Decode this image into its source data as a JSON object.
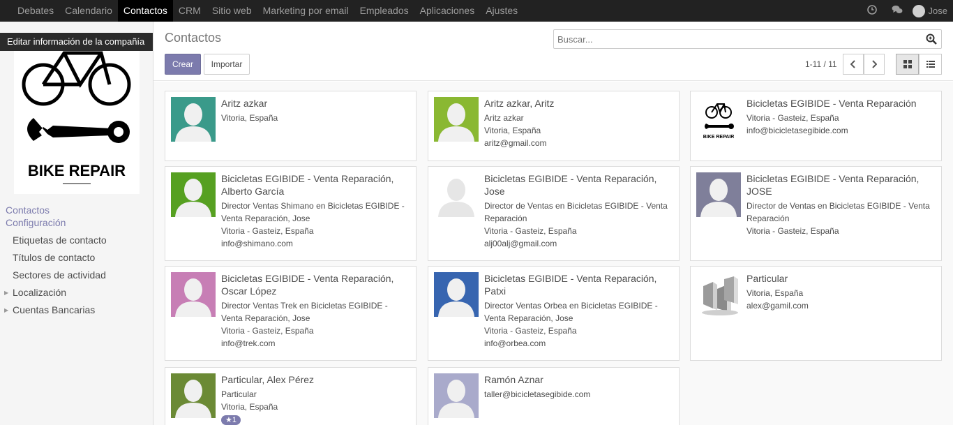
{
  "navbar": {
    "menu": [
      "Debates",
      "Calendario",
      "Contactos",
      "CRM",
      "Sitio web",
      "Marketing por email",
      "Empleados",
      "Aplicaciones",
      "Ajustes"
    ],
    "active_index": 2,
    "user": "Jose",
    "icons": [
      "clock-icon",
      "chat-icon"
    ]
  },
  "sidebar": {
    "tooltip": "Editar información de la compañía",
    "logo_text": "BIKE REPAIR",
    "sections": [
      "Contactos",
      "Configuración"
    ],
    "items": [
      "Etiquetas de contacto",
      "Títulos de contacto",
      "Sectores de actividad",
      "Localización",
      "Cuentas Bancarias"
    ]
  },
  "control": {
    "title": "Contactos",
    "search_placeholder": "Buscar...",
    "create_label": "Crear",
    "import_label": "Importar",
    "pager": "1-11 / 11"
  },
  "colors": {
    "accent": "#7c7bad",
    "navbar": "#222222"
  },
  "contacts": [
    {
      "name": "Aritz azkar",
      "lines": [
        "Vitoria, España"
      ],
      "avatar_color": "#3a9a8a"
    },
    {
      "name": "Aritz azkar, Aritz",
      "lines": [
        "Aritz azkar",
        "Vitoria, España",
        "aritz@gmail.com"
      ],
      "avatar_color": "#8ab832"
    },
    {
      "name": "Bicicletas EGIBIDE - Venta Reparación",
      "lines": [
        "Vitoria - Gasteiz, España",
        "info@bicicletasegibide.com"
      ],
      "avatar_color": "logo"
    },
    {
      "name": "Bicicletas EGIBIDE - Venta Reparación, Alberto García",
      "lines": [
        "Director Ventas Shimano en Bicicletas EGIBIDE - Venta Reparación, Jose",
        "Vitoria - Gasteiz, España",
        "info@shimano.com"
      ],
      "avatar_color": "#56a021"
    },
    {
      "name": "Bicicletas EGIBIDE - Venta Reparación, Jose",
      "lines": [
        "Director de Ventas en Bicicletas EGIBIDE - Venta Reparación",
        "Vitoria - Gasteiz, España",
        "alj00alj@gmail.com"
      ],
      "avatar_color": "#ffffff"
    },
    {
      "name": "Bicicletas EGIBIDE - Venta Reparación, JOSE",
      "lines": [
        "Director de Ventas en Bicicletas EGIBIDE - Venta Reparación",
        "Vitoria - Gasteiz, España"
      ],
      "avatar_color": "#7f7f9a"
    },
    {
      "name": "Bicicletas EGIBIDE - Venta Reparación, Oscar López",
      "lines": [
        "Director Ventas Trek en Bicicletas EGIBIDE - Venta Reparación, Jose",
        "Vitoria - Gasteiz, España",
        "info@trek.com"
      ],
      "avatar_color": "#c77eb5"
    },
    {
      "name": "Bicicletas EGIBIDE - Venta Reparación, Patxi",
      "lines": [
        "Director Ventas Orbea en Bicicletas EGIBIDE - Venta Reparación, Jose",
        "Vitoria - Gasteiz, España",
        "info@orbea.com"
      ],
      "avatar_color": "#3765b0"
    },
    {
      "name": "Particular",
      "lines": [
        "Vitoria, España",
        "alex@gamil.com"
      ],
      "avatar_color": "building"
    },
    {
      "name": "Particular, Alex Pérez",
      "lines": [
        "Particular",
        "Vitoria, España"
      ],
      "avatar_color": "#6b8a35",
      "badge": "1"
    },
    {
      "name": "Ramón Aznar",
      "lines": [
        "taller@bicicletasegibide.com"
      ],
      "avatar_color": "#a9aacb"
    }
  ]
}
